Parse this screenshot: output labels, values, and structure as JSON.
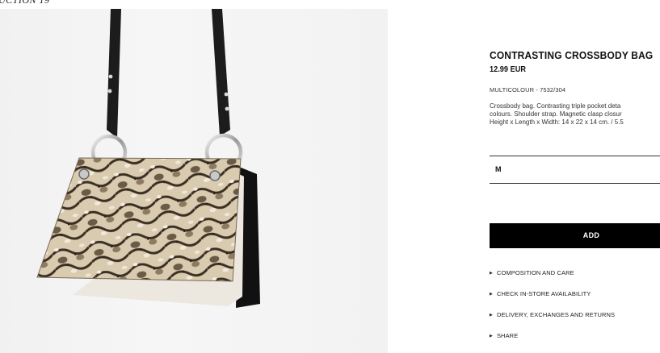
{
  "top_label": "UCTION 19",
  "product": {
    "title": "CONTRASTING CROSSBODY BAG",
    "price": "12.99 EUR",
    "reference": "MULTICOLOUR - 7532/304",
    "description_lines": [
      "Crossbody bag. Contrasting triple pocket deta",
      "colours. Shoulder strap. Magnetic clasp closur",
      "Height x Length x Width: 14 x 22 x 14 cm. / 5.5"
    ],
    "size": "M",
    "add_label": "ADD"
  },
  "links": [
    {
      "label": "COMPOSITION AND CARE",
      "icon": "triangle-right-icon"
    },
    {
      "label": "CHECK IN-STORE AVAILABILITY",
      "icon": "triangle-right-icon"
    },
    {
      "label": "DELIVERY, EXCHANGES AND RETURNS",
      "icon": "triangle-right-icon"
    },
    {
      "label": "SHARE",
      "icon": "triangle-right-icon"
    }
  ],
  "colors": {
    "button": "#000000",
    "button_text": "#ffffff",
    "image_background": "#f3f3f3",
    "strap": "#1a1a1a"
  }
}
